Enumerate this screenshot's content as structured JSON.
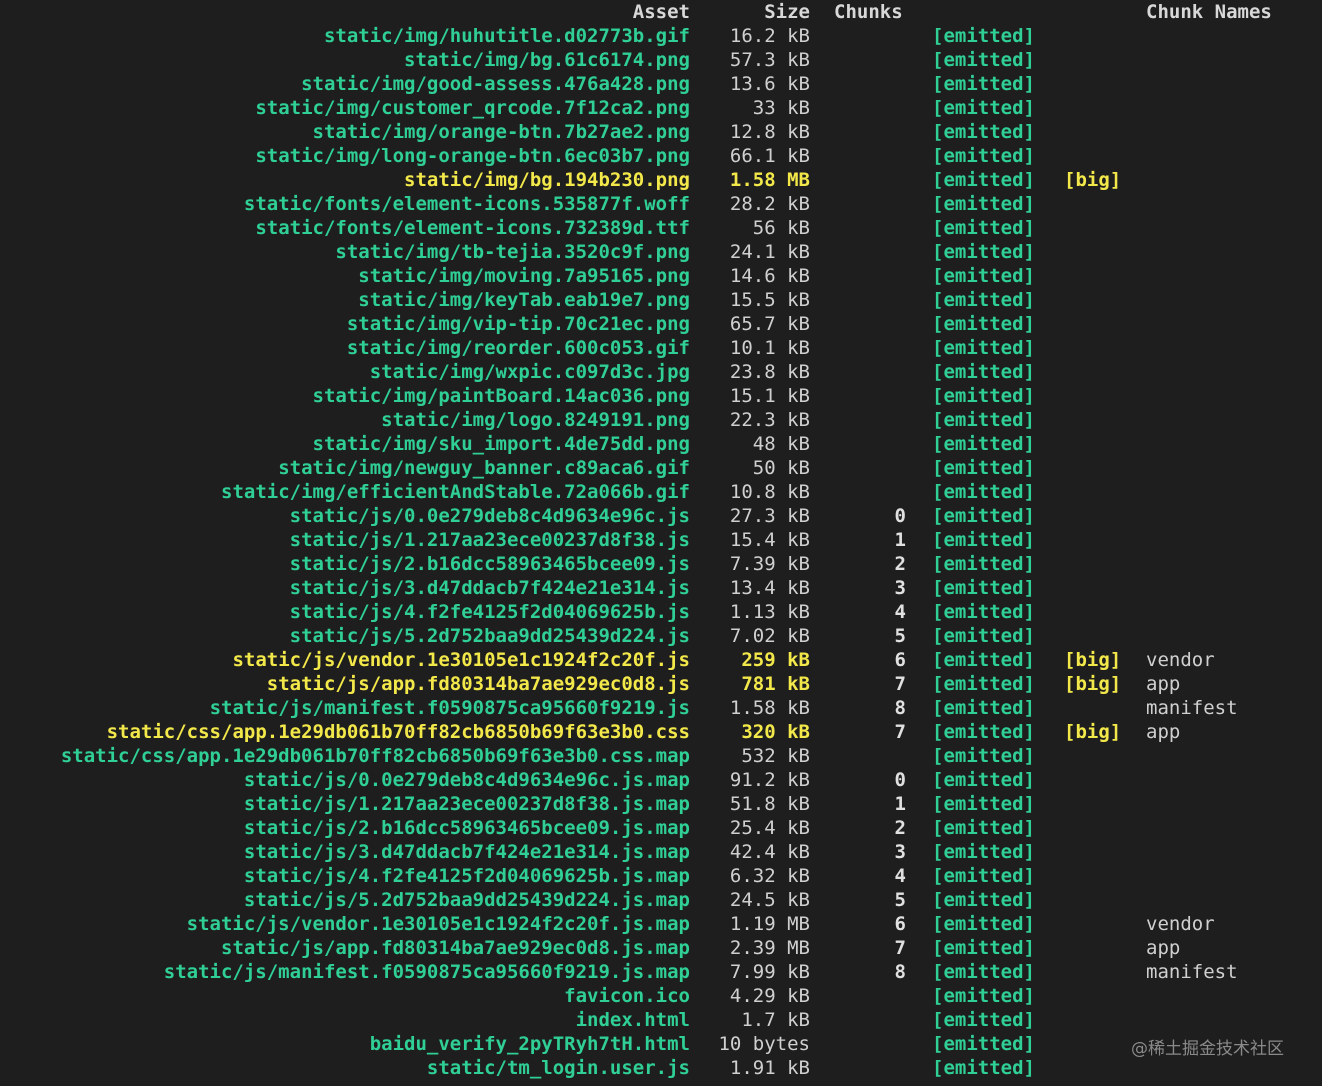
{
  "columns": {
    "asset": "Asset",
    "size": "Size",
    "chunks": "Chunks",
    "chunk_names": "Chunk Names"
  },
  "rows": [
    {
      "asset": "static/img/huhutitle.d02773b.gif",
      "size": "16.2 kB",
      "chunk": "",
      "status": "[emitted]",
      "flag": "",
      "name": "",
      "big": false
    },
    {
      "asset": "static/img/bg.61c6174.png",
      "size": "57.3 kB",
      "chunk": "",
      "status": "[emitted]",
      "flag": "",
      "name": "",
      "big": false
    },
    {
      "asset": "static/img/good-assess.476a428.png",
      "size": "13.6 kB",
      "chunk": "",
      "status": "[emitted]",
      "flag": "",
      "name": "",
      "big": false
    },
    {
      "asset": "static/img/customer_qrcode.7f12ca2.png",
      "size": "33 kB",
      "chunk": "",
      "status": "[emitted]",
      "flag": "",
      "name": "",
      "big": false
    },
    {
      "asset": "static/img/orange-btn.7b27ae2.png",
      "size": "12.8 kB",
      "chunk": "",
      "status": "[emitted]",
      "flag": "",
      "name": "",
      "big": false
    },
    {
      "asset": "static/img/long-orange-btn.6ec03b7.png",
      "size": "66.1 kB",
      "chunk": "",
      "status": "[emitted]",
      "flag": "",
      "name": "",
      "big": false
    },
    {
      "asset": "static/img/bg.194b230.png",
      "size": "1.58 MB",
      "chunk": "",
      "status": "[emitted]",
      "flag": "[big]",
      "name": "",
      "big": true
    },
    {
      "asset": "static/fonts/element-icons.535877f.woff",
      "size": "28.2 kB",
      "chunk": "",
      "status": "[emitted]",
      "flag": "",
      "name": "",
      "big": false
    },
    {
      "asset": "static/fonts/element-icons.732389d.ttf",
      "size": "56 kB",
      "chunk": "",
      "status": "[emitted]",
      "flag": "",
      "name": "",
      "big": false
    },
    {
      "asset": "static/img/tb-tejia.3520c9f.png",
      "size": "24.1 kB",
      "chunk": "",
      "status": "[emitted]",
      "flag": "",
      "name": "",
      "big": false
    },
    {
      "asset": "static/img/moving.7a95165.png",
      "size": "14.6 kB",
      "chunk": "",
      "status": "[emitted]",
      "flag": "",
      "name": "",
      "big": false
    },
    {
      "asset": "static/img/keyTab.eab19e7.png",
      "size": "15.5 kB",
      "chunk": "",
      "status": "[emitted]",
      "flag": "",
      "name": "",
      "big": false
    },
    {
      "asset": "static/img/vip-tip.70c21ec.png",
      "size": "65.7 kB",
      "chunk": "",
      "status": "[emitted]",
      "flag": "",
      "name": "",
      "big": false
    },
    {
      "asset": "static/img/reorder.600c053.gif",
      "size": "10.1 kB",
      "chunk": "",
      "status": "[emitted]",
      "flag": "",
      "name": "",
      "big": false
    },
    {
      "asset": "static/img/wxpic.c097d3c.jpg",
      "size": "23.8 kB",
      "chunk": "",
      "status": "[emitted]",
      "flag": "",
      "name": "",
      "big": false
    },
    {
      "asset": "static/img/paintBoard.14ac036.png",
      "size": "15.1 kB",
      "chunk": "",
      "status": "[emitted]",
      "flag": "",
      "name": "",
      "big": false
    },
    {
      "asset": "static/img/logo.8249191.png",
      "size": "22.3 kB",
      "chunk": "",
      "status": "[emitted]",
      "flag": "",
      "name": "",
      "big": false
    },
    {
      "asset": "static/img/sku_import.4de75dd.png",
      "size": "48 kB",
      "chunk": "",
      "status": "[emitted]",
      "flag": "",
      "name": "",
      "big": false
    },
    {
      "asset": "static/img/newguy_banner.c89aca6.gif",
      "size": "50 kB",
      "chunk": "",
      "status": "[emitted]",
      "flag": "",
      "name": "",
      "big": false
    },
    {
      "asset": "static/img/efficientAndStable.72a066b.gif",
      "size": "10.8 kB",
      "chunk": "",
      "status": "[emitted]",
      "flag": "",
      "name": "",
      "big": false
    },
    {
      "asset": "static/js/0.0e279deb8c4d9634e96c.js",
      "size": "27.3 kB",
      "chunk": "0",
      "status": "[emitted]",
      "flag": "",
      "name": "",
      "big": false
    },
    {
      "asset": "static/js/1.217aa23ece00237d8f38.js",
      "size": "15.4 kB",
      "chunk": "1",
      "status": "[emitted]",
      "flag": "",
      "name": "",
      "big": false
    },
    {
      "asset": "static/js/2.b16dcc58963465bcee09.js",
      "size": "7.39 kB",
      "chunk": "2",
      "status": "[emitted]",
      "flag": "",
      "name": "",
      "big": false
    },
    {
      "asset": "static/js/3.d47ddacb7f424e21e314.js",
      "size": "13.4 kB",
      "chunk": "3",
      "status": "[emitted]",
      "flag": "",
      "name": "",
      "big": false
    },
    {
      "asset": "static/js/4.f2fe4125f2d04069625b.js",
      "size": "1.13 kB",
      "chunk": "4",
      "status": "[emitted]",
      "flag": "",
      "name": "",
      "big": false
    },
    {
      "asset": "static/js/5.2d752baa9dd25439d224.js",
      "size": "7.02 kB",
      "chunk": "5",
      "status": "[emitted]",
      "flag": "",
      "name": "",
      "big": false
    },
    {
      "asset": "static/js/vendor.1e30105e1c1924f2c20f.js",
      "size": "259 kB",
      "chunk": "6",
      "status": "[emitted]",
      "flag": "[big]",
      "name": "vendor",
      "big": true
    },
    {
      "asset": "static/js/app.fd80314ba7ae929ec0d8.js",
      "size": "781 kB",
      "chunk": "7",
      "status": "[emitted]",
      "flag": "[big]",
      "name": "app",
      "big": true
    },
    {
      "asset": "static/js/manifest.f0590875ca95660f9219.js",
      "size": "1.58 kB",
      "chunk": "8",
      "status": "[emitted]",
      "flag": "",
      "name": "manifest",
      "big": false
    },
    {
      "asset": "static/css/app.1e29db061b70ff82cb6850b69f63e3b0.css",
      "size": "320 kB",
      "chunk": "7",
      "status": "[emitted]",
      "flag": "[big]",
      "name": "app",
      "big": true
    },
    {
      "asset": "static/css/app.1e29db061b70ff82cb6850b69f63e3b0.css.map",
      "size": "532 kB",
      "chunk": "",
      "status": "[emitted]",
      "flag": "",
      "name": "",
      "big": false
    },
    {
      "asset": "static/js/0.0e279deb8c4d9634e96c.js.map",
      "size": "91.2 kB",
      "chunk": "0",
      "status": "[emitted]",
      "flag": "",
      "name": "",
      "big": false
    },
    {
      "asset": "static/js/1.217aa23ece00237d8f38.js.map",
      "size": "51.8 kB",
      "chunk": "1",
      "status": "[emitted]",
      "flag": "",
      "name": "",
      "big": false
    },
    {
      "asset": "static/js/2.b16dcc58963465bcee09.js.map",
      "size": "25.4 kB",
      "chunk": "2",
      "status": "[emitted]",
      "flag": "",
      "name": "",
      "big": false
    },
    {
      "asset": "static/js/3.d47ddacb7f424e21e314.js.map",
      "size": "42.4 kB",
      "chunk": "3",
      "status": "[emitted]",
      "flag": "",
      "name": "",
      "big": false
    },
    {
      "asset": "static/js/4.f2fe4125f2d04069625b.js.map",
      "size": "6.32 kB",
      "chunk": "4",
      "status": "[emitted]",
      "flag": "",
      "name": "",
      "big": false
    },
    {
      "asset": "static/js/5.2d752baa9dd25439d224.js.map",
      "size": "24.5 kB",
      "chunk": "5",
      "status": "[emitted]",
      "flag": "",
      "name": "",
      "big": false
    },
    {
      "asset": "static/js/vendor.1e30105e1c1924f2c20f.js.map",
      "size": "1.19 MB",
      "chunk": "6",
      "status": "[emitted]",
      "flag": "",
      "name": "vendor",
      "big": false
    },
    {
      "asset": "static/js/app.fd80314ba7ae929ec0d8.js.map",
      "size": "2.39 MB",
      "chunk": "7",
      "status": "[emitted]",
      "flag": "",
      "name": "app",
      "big": false
    },
    {
      "asset": "static/js/manifest.f0590875ca95660f9219.js.map",
      "size": "7.99 kB",
      "chunk": "8",
      "status": "[emitted]",
      "flag": "",
      "name": "manifest",
      "big": false
    },
    {
      "asset": "favicon.ico",
      "size": "4.29 kB",
      "chunk": "",
      "status": "[emitted]",
      "flag": "",
      "name": "",
      "big": false
    },
    {
      "asset": "index.html",
      "size": "1.7 kB",
      "chunk": "",
      "status": "[emitted]",
      "flag": "",
      "name": "",
      "big": false
    },
    {
      "asset": "baidu_verify_2pyTRyh7tH.html",
      "size": "10 bytes",
      "chunk": "",
      "status": "[emitted]",
      "flag": "",
      "name": "",
      "big": false
    },
    {
      "asset": "static/tm_login.user.js",
      "size": "1.91 kB",
      "chunk": "",
      "status": "[emitted]",
      "flag": "",
      "name": "",
      "big": false
    }
  ],
  "watermark": "@稀土掘金技术社区",
  "colors": {
    "background": "#1e1e1e",
    "asset_green": "#2fcf95",
    "big_yellow": "#f3e84a",
    "text_gray": "#d0d0d0"
  }
}
